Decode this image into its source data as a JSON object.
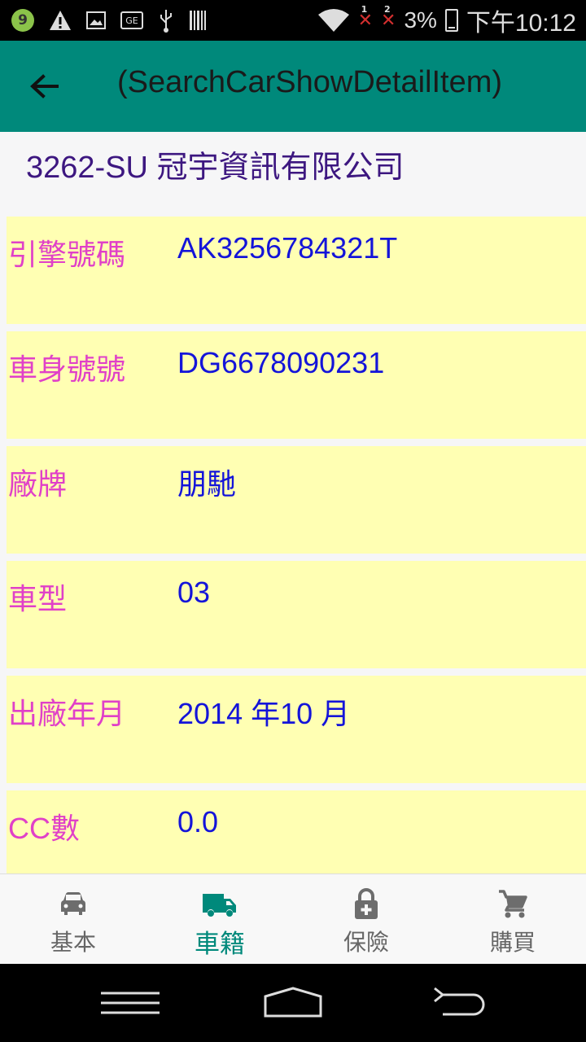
{
  "status_bar": {
    "notification_badge": "9",
    "sim_labels": [
      "1",
      "2"
    ],
    "battery_percent": "3%",
    "time": "下午10:12",
    "icons": [
      "warning-icon",
      "image-icon",
      "ge-icon",
      "usb-icon",
      "barcode-icon",
      "wifi-icon",
      "signal-icon",
      "battery-icon"
    ]
  },
  "toolbar": {
    "title": "(SearchCarShowDetailItem)",
    "back_icon": "arrow-back-icon"
  },
  "company_header": "3262-SU 冠宇資訊有限公司",
  "details": [
    {
      "label": "引擎號碼",
      "value": "AK3256784321T"
    },
    {
      "label": "車身號號",
      "value": "DG6678090231"
    },
    {
      "label": "廠牌",
      "value": "朋馳"
    },
    {
      "label": "車型",
      "value": "03"
    },
    {
      "label": "出廠年月",
      "value": "2014 年10 月"
    },
    {
      "label": "CC數",
      "value": "0.0"
    }
  ],
  "bottom_nav": {
    "active_index": 1,
    "items": [
      {
        "label": "基本",
        "icon": "car-icon"
      },
      {
        "label": "車籍",
        "icon": "truck-icon"
      },
      {
        "label": "保險",
        "icon": "lock-plus-icon"
      },
      {
        "label": "購買",
        "icon": "cart-icon"
      }
    ]
  },
  "colors": {
    "toolbar": "#00897b",
    "row_background": "#ffffb3",
    "label": "#e040c8",
    "value": "#1414d9",
    "company": "#3d1780",
    "nav_active": "#00897b",
    "nav_inactive": "#666666"
  }
}
